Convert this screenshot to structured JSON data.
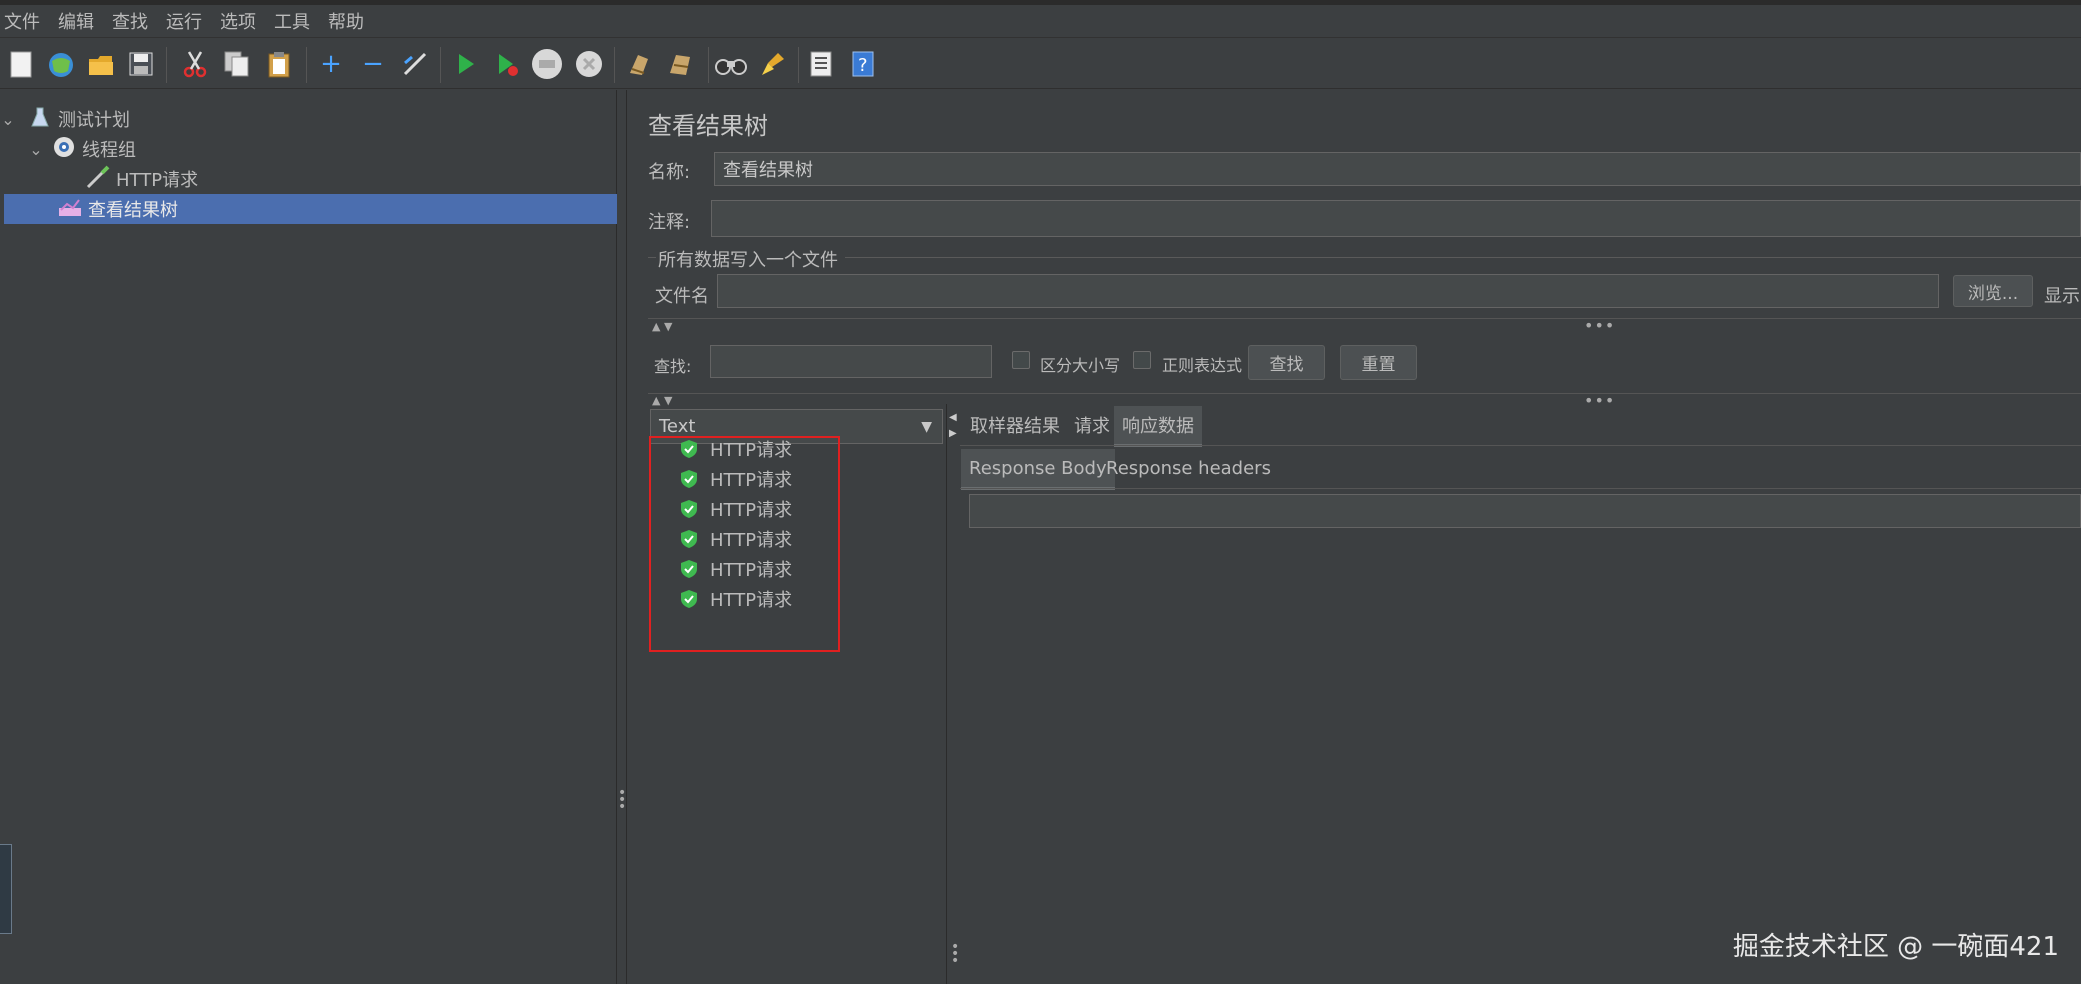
{
  "menu": [
    "文件",
    "编辑",
    "查找",
    "运行",
    "选项",
    "工具",
    "帮助"
  ],
  "toolbar_icons": [
    "new-icon",
    "templates-icon",
    "open-icon",
    "save-icon",
    "cut-icon",
    "copy-icon",
    "paste-icon",
    "expand-icon",
    "collapse-icon",
    "toggle-icon",
    "start-icon",
    "start-no-pause-icon",
    "stop-icon",
    "shutdown-icon",
    "clear-icon",
    "clear-all-icon",
    "search-icon",
    "reset-search-icon",
    "function-helper-icon",
    "help-icon"
  ],
  "tree": {
    "test_plan": "测试计划",
    "thread_group": "线程组",
    "http_request": "HTTP请求",
    "results_tree": "查看结果树"
  },
  "panel": {
    "title": "查看结果树",
    "name_label": "名称:",
    "name_value": "查看结果树",
    "comment_label": "注释:",
    "comment_value": "",
    "file_group_title": "所有数据写入一个文件",
    "filename_label": "文件名",
    "filename_value": "",
    "browse_button": "浏览...",
    "display_label": "显示",
    "search_label": "查找:",
    "search_value": "",
    "case_sensitive": "区分大小写",
    "regex": "正则表达式",
    "search_button": "查找",
    "reset_button": "重置"
  },
  "renderer": {
    "selected": "Text"
  },
  "results": [
    "HTTP请求",
    "HTTP请求",
    "HTTP请求",
    "HTTP请求",
    "HTTP请求",
    "HTTP请求"
  ],
  "tabs": {
    "sampler_result": "取样器结果",
    "request": "请求",
    "response_data": "响应数据"
  },
  "subtabs": {
    "response_body": "Response Body",
    "response_headers": "Response headers"
  },
  "watermark": "掘金技术社区 @ 一碗面421",
  "colors": {
    "background": "#3c3f41",
    "selection": "#4b6eaf",
    "success_green": "#3fb950",
    "highlight_red": "#e02020"
  }
}
